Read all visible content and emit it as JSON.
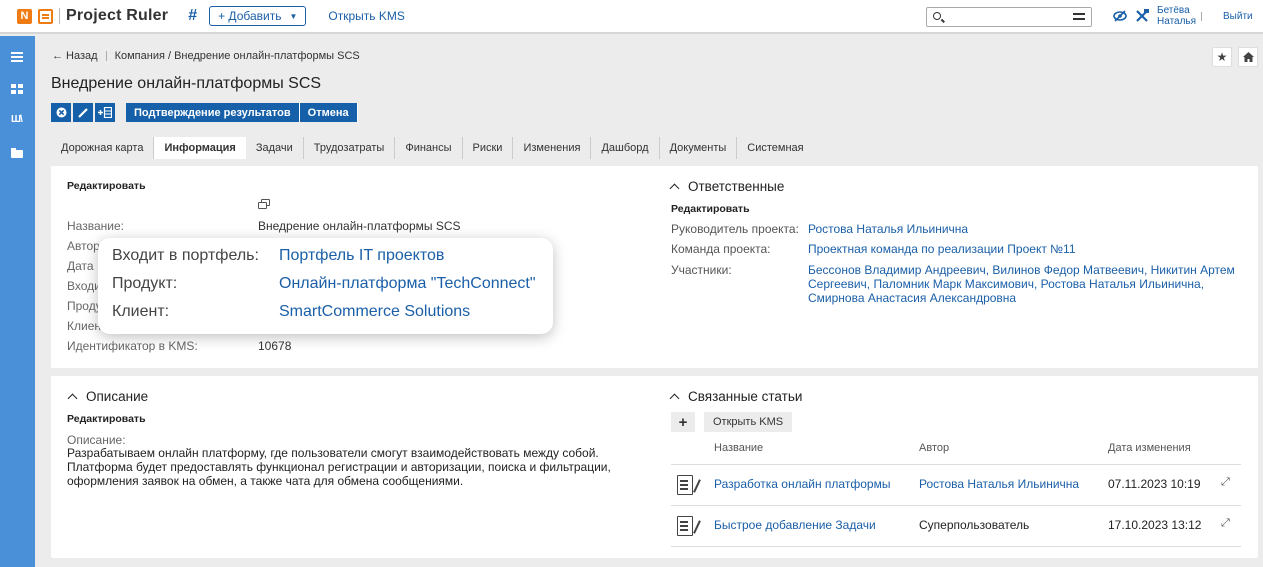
{
  "topbar": {
    "logo_letter": "N",
    "brand": "Project Ruler",
    "hash": "#",
    "add_label": "+ Добавить",
    "kms_link": "Открыть KMS",
    "user_line1": "Бетёва",
    "user_line2": "Наталья",
    "logout": "Выйти"
  },
  "breadcrumb": {
    "back": "← Назад",
    "path": "Компания / Внедрение онлайн-платформы SCS"
  },
  "page": {
    "title": "Внедрение онлайн-платформы SCS",
    "actions": [
      "Подтверждение результатов",
      "Отмена"
    ]
  },
  "tabs": [
    "Дорожная карта",
    "Информация",
    "Задачи",
    "Трудозатраты",
    "Финансы",
    "Риски",
    "Изменения",
    "Дашборд",
    "Документы",
    "Системная"
  ],
  "info": {
    "edit": "Редактировать",
    "name_label": "Название:",
    "name_value": "Внедрение онлайн-платформы SCS",
    "partial_labels": [
      "Автор",
      "Дата",
      "Входи",
      "Проду",
      "Клиен"
    ],
    "kms_id_label": "Идентификатор в KMS:",
    "kms_id_value": "10678"
  },
  "popup": {
    "portfolio_label": "Входит в портфель:",
    "portfolio_value": "Портфель IT проектов",
    "product_label": "Продукт:",
    "product_value": "Онлайн-платформа \"TechConnect\"",
    "client_label": "Клиент:",
    "client_value": "SmartCommerce Solutions"
  },
  "responsible": {
    "title": "Ответственные",
    "edit": "Редактировать",
    "manager_label": "Руководитель проекта:",
    "manager_value": "Ростова Наталья Ильинична",
    "team_label": "Команда проекта:",
    "team_value": "Проектная команда по реализации Проект №11",
    "members_label": "Участники:",
    "members_value": "Бессонов Владимир Андреевич, Вилинов Федор Матвеевич, Никитин Артем Сергеевич, Паломник Марк Максимович, Ростова Наталья Ильинична, Смирнова Анастасия Александровна"
  },
  "description": {
    "title": "Описание",
    "edit": "Редактировать",
    "label": "Описание:",
    "text": "Разрабатываем онлайн платформу, где пользователи смогут взаимодействовать между собой. Платформа будет предоставлять функционал регистрации и авторизации, поиска и фильтрации, оформления заявок на обмен, а также чата для обмена сообщениями."
  },
  "articles": {
    "title": "Связанные статьи",
    "plus": "+",
    "open_kms": "Открыть KMS",
    "headers": [
      "Название",
      "Автор",
      "Дата изменения"
    ],
    "rows": [
      {
        "name": "Разработка онлайн платформы",
        "author": "Ростова Наталья Ильинична",
        "date": "07.11.2023 10:19"
      },
      {
        "name": "Быстрое добавление Задачи",
        "author": "Суперпользователь",
        "date": "17.10.2023 13:12"
      }
    ]
  },
  "colors": {
    "accent": "#1560a8",
    "link": "#1a5fa8",
    "sidebar": "#4a90d9",
    "logo": "#f07b13"
  }
}
